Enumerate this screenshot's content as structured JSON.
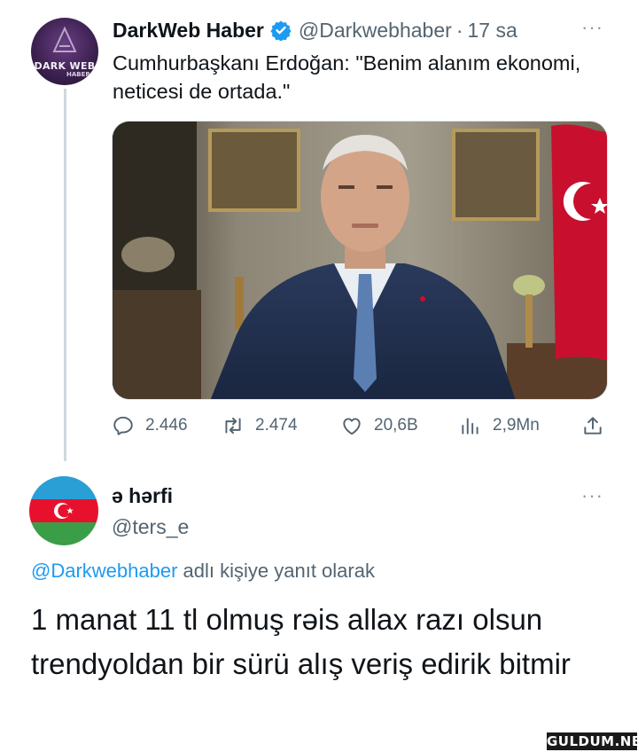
{
  "tweet": {
    "author_name": "DarkWeb Haber",
    "author_handle": "@Darkwebhaber",
    "separator": "·",
    "time": "17 sa",
    "avatar_text": "DARK WEB",
    "avatar_subtext": "HABER",
    "text": "Cumhurbaşkanı Erdoğan: \"Benim alanım ekonomi, neticesi de ortada.\"",
    "stats": {
      "replies": "2.446",
      "retweets": "2.474",
      "likes": "20,6B",
      "views": "2,9Mn"
    }
  },
  "reply": {
    "author_name": "ə hərfi",
    "author_handle": "@ters_e",
    "reply_to_handle": "@Darkwebhaber",
    "reply_to_suffix": " adlı kişiye yanıt olarak",
    "text": "1 manat 11 tl olmuş rəis allax razı olsun trendyoldan bir sürü alış veriş edirik bitmir"
  },
  "watermark": "GULDUM.NET",
  "icons": [
    "verified-badge-icon",
    "more-icon",
    "reply-icon",
    "retweet-icon",
    "like-icon",
    "views-icon",
    "share-icon"
  ],
  "colors": {
    "link": "#1d9bf0",
    "secondary_text": "#536471",
    "verified": "#1d9bf0"
  }
}
